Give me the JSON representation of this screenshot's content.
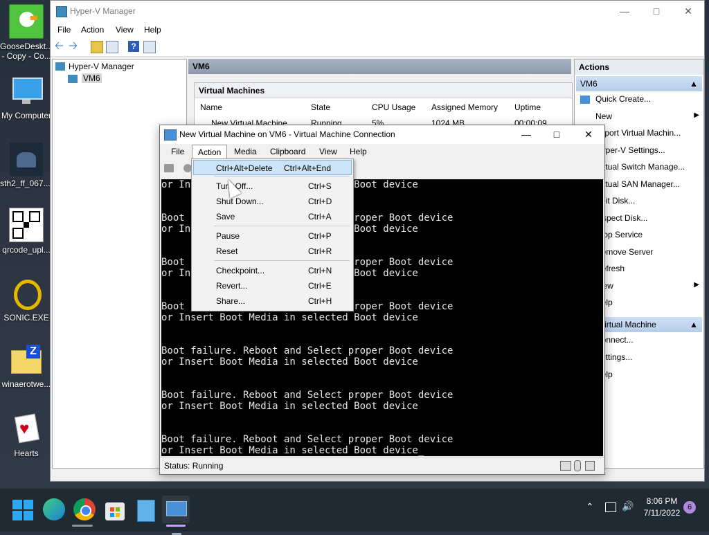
{
  "desktop": {
    "icons": [
      {
        "label": "GooseDeskt... - Copy - Co...",
        "icon": "goose-icon"
      },
      {
        "label": "My Computer",
        "icon": "monitor-icon"
      },
      {
        "label": "sth2_ff_067....",
        "icon": "game-image-icon"
      },
      {
        "label": "qrcode_upl...",
        "icon": "qrcode-icon"
      },
      {
        "label": "SONIC.EXE",
        "icon": "gold-ring-icon"
      },
      {
        "label": "winaerotwe...",
        "icon": "zip-folder-icon"
      },
      {
        "label": "Hearts",
        "icon": "hearts-card-icon"
      }
    ]
  },
  "hyperv": {
    "title": "Hyper-V Manager",
    "menu": [
      "File",
      "Action",
      "View",
      "Help"
    ],
    "tree": {
      "root": "Hyper-V Manager",
      "child": "VM6"
    },
    "center_header": "VM6",
    "vm_section_title": "Virtual Machines",
    "columns": [
      "Name",
      "State",
      "CPU Usage",
      "Assigned Memory",
      "Uptime"
    ],
    "rows": [
      {
        "name": "New Virtual Machine",
        "state": "Running",
        "cpu": "5%",
        "memory": "1024 MB",
        "uptime": "00:00:09"
      }
    ],
    "actions_header": "Actions",
    "actions_section1": "VM6",
    "actions_list1": [
      "Quick Create...",
      "New",
      "Import Virtual Machin...",
      "Hyper-V Settings...",
      "Virtual Switch Manage...",
      "Virtual SAN Manager...",
      "Edit Disk...",
      "Inspect Disk...",
      "Stop Service",
      "Remove Server",
      "Refresh",
      "View",
      "Help"
    ],
    "actions_section2": "New Virtual Machine",
    "actions_list2": [
      "Connect...",
      "Settings...",
      "Help"
    ]
  },
  "vmconnect": {
    "title": "New Virtual Machine on VM6 - Virtual Machine Connection",
    "menu": [
      "File",
      "Action",
      "Media",
      "Clipboard",
      "View",
      "Help"
    ],
    "status": "Status: Running",
    "console_lines": [
      "or Insert Boot Media in selected Boot device",
      "",
      "",
      "Boot failure. Reboot and Select proper Boot device",
      "or Insert Boot Media in selected Boot device",
      "",
      "",
      "Boot failure. Reboot and Select proper Boot device",
      "or Insert Boot Media in selected Boot device",
      "",
      "",
      "Boot failure. Reboot and Select proper Boot device",
      "or Insert Boot Media in selected Boot device",
      "",
      "",
      "Boot failure. Reboot and Select proper Boot device",
      "or Insert Boot Media in selected Boot device",
      "",
      "",
      "Boot failure. Reboot and Select proper Boot device",
      "or Insert Boot Media in selected Boot device",
      "",
      "",
      "Boot failure. Reboot and Select proper Boot device",
      "or Insert Boot Media in selected Boot device_"
    ]
  },
  "action_menu": {
    "items": [
      {
        "label": "Ctrl+Alt+Delete",
        "shortcut": "Ctrl+Alt+End",
        "highlighted": true
      },
      {
        "label": "Turn Off...",
        "shortcut": "Ctrl+S"
      },
      {
        "label": "Shut Down...",
        "shortcut": "Ctrl+D"
      },
      {
        "label": "Save",
        "shortcut": "Ctrl+A"
      },
      {
        "label": "Pause",
        "shortcut": "Ctrl+P"
      },
      {
        "label": "Reset",
        "shortcut": "Ctrl+R"
      },
      {
        "label": "Checkpoint...",
        "shortcut": "Ctrl+N"
      },
      {
        "label": "Revert...",
        "shortcut": "Ctrl+E"
      },
      {
        "label": "Share...",
        "shortcut": "Ctrl+H"
      }
    ]
  },
  "taskbar": {
    "time": "8:06 PM",
    "date": "7/11/2022",
    "notification_count": "6",
    "apps": [
      "start-icon",
      "edge-icon",
      "chrome-icon",
      "store-icon",
      "building-icon",
      "vmconnect-icon"
    ]
  },
  "colors": {
    "accent": "#0078d7",
    "console_bg": "#000000",
    "highlight": "#cce4f7"
  }
}
